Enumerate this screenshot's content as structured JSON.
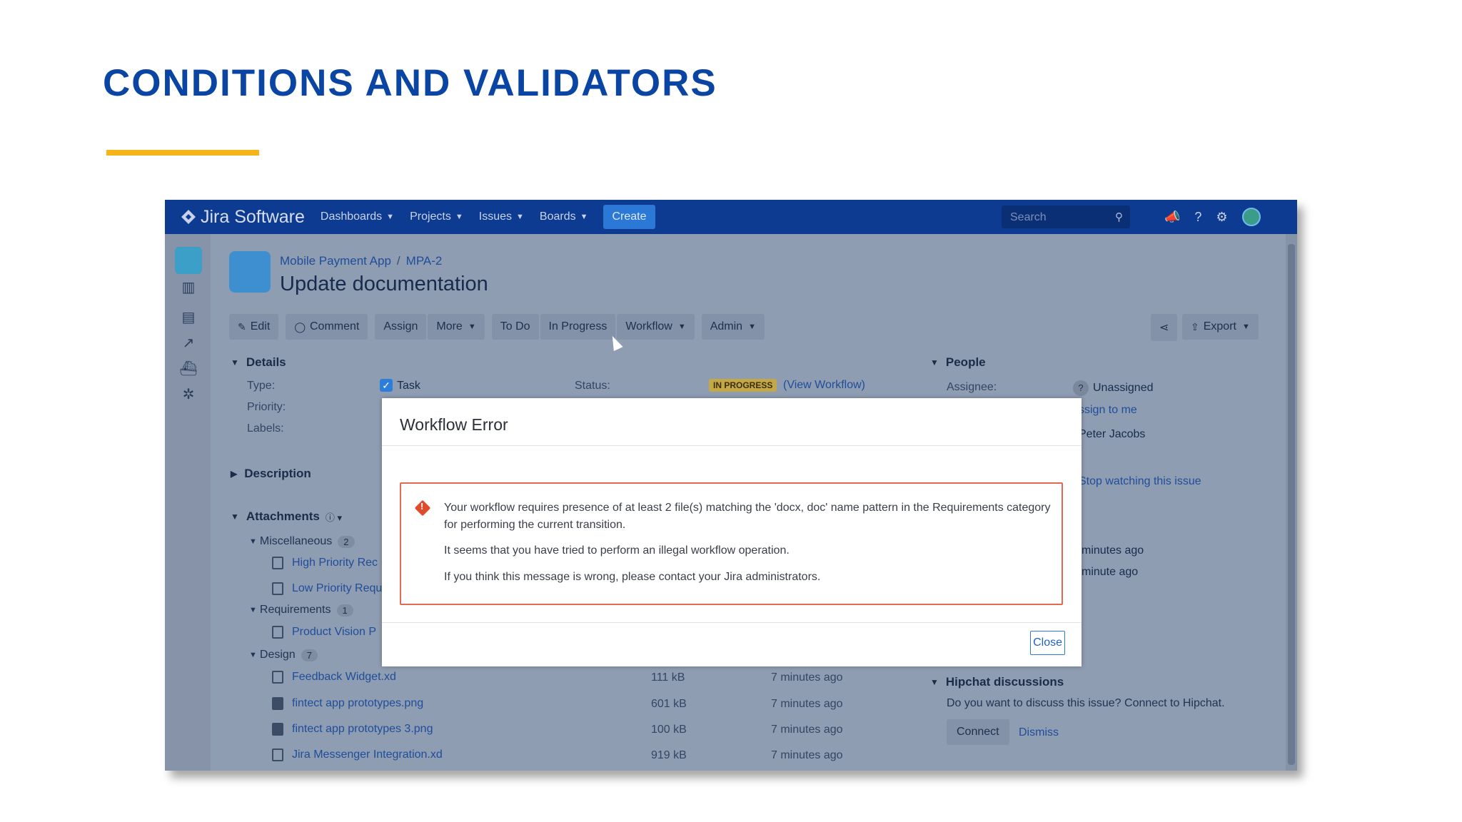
{
  "slide": {
    "title": "CONDITIONS AND VALIDATORS"
  },
  "jira": {
    "brand": "Jira Software",
    "nav": [
      "Dashboards",
      "Projects",
      "Issues",
      "Boards"
    ],
    "create": "Create",
    "search_placeholder": "Search",
    "breadcrumb": {
      "project": "Mobile Payment App",
      "issue_key": "MPA-2"
    },
    "issue_title": "Update documentation",
    "toolbar": {
      "edit": "Edit",
      "comment": "Comment",
      "assign": "Assign",
      "more": "More",
      "todo": "To Do",
      "in_progress": "In Progress",
      "workflow": "Workflow",
      "admin": "Admin",
      "export": "Export"
    },
    "details": {
      "heading": "Details",
      "type_label": "Type:",
      "type_value": "Task",
      "priority_label": "Priority:",
      "labels_label": "Labels:",
      "status_label": "Status:",
      "status_badge": "IN PROGRESS",
      "view_workflow": "(View Workflow)"
    },
    "description_heading": "Description",
    "attachments": {
      "heading": "Attachments",
      "groups": [
        {
          "name": "Miscellaneous",
          "count": "2"
        },
        {
          "name": "Requirements",
          "count": "1"
        },
        {
          "name": "Design",
          "count": "7"
        }
      ],
      "misc_files": [
        "High Priority Rec",
        "Low Priority Requ"
      ],
      "req_files": [
        "Product Vision P"
      ],
      "design_files": [
        {
          "name": "Feedback Widget.xd",
          "size": "111 kB",
          "time": "7 minutes ago"
        },
        {
          "name": "fintect app prototypes.png",
          "size": "601 kB",
          "time": "7 minutes ago"
        },
        {
          "name": "fintect app prototypes 3.png",
          "size": "100 kB",
          "time": "7 minutes ago"
        },
        {
          "name": "Jira Messenger Integration.xd",
          "size": "919 kB",
          "time": "7 minutes ago"
        }
      ]
    },
    "people": {
      "heading": "People",
      "assignee_label": "Assignee:",
      "assignee_value": "Unassigned",
      "assign_to_me": "ssign to me",
      "reporter": "Peter Jacobs",
      "watch": "Stop watching this issue",
      "dates": [
        "minutes ago",
        "minute ago"
      ]
    },
    "hipchat": {
      "heading": "Hipchat discussions",
      "text": "Do you want to discuss this issue? Connect to Hipchat.",
      "connect": "Connect",
      "dismiss": "Dismiss"
    }
  },
  "modal": {
    "title": "Workflow Error",
    "lines": [
      "Your workflow requires presence of at least 2 file(s) matching the 'docx, doc' name pattern in the Requirements category for performing the current transition.",
      "It seems that you have tried to perform an illegal workflow operation.",
      "If you think this message is wrong, please contact your Jira administrators."
    ],
    "close": "Close"
  }
}
